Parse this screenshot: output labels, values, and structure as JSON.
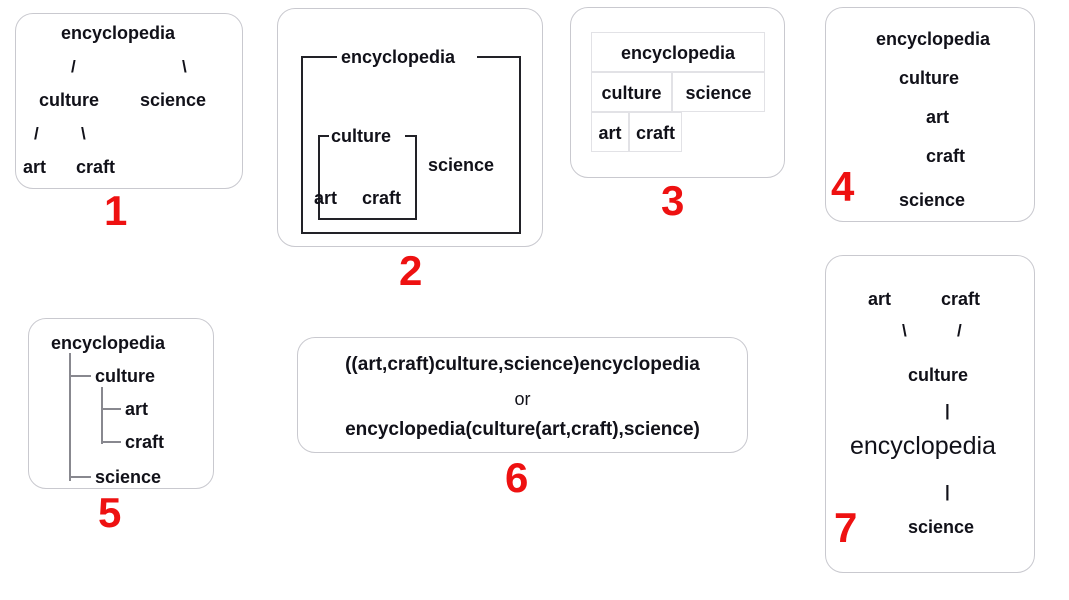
{
  "terms": {
    "encyclopedia": "encyclopedia",
    "culture": "culture",
    "science": "science",
    "art": "art",
    "craft": "craft"
  },
  "colors": {
    "number_red": "#ee1111",
    "panel_border": "#c9c9cf",
    "box_stroke": "#222228",
    "table_grid": "#e2e2e6",
    "tree_connector": "#88888f",
    "text": "#111119",
    "background": "#ffffff"
  },
  "panels": [
    {
      "number": "1",
      "style": "slash-tree",
      "nodes": {
        "root": "encyclopedia",
        "left_branch": "/",
        "right_branch": "\\",
        "level2_left": "culture",
        "level2_right": "science",
        "left_branch2": "/",
        "right_branch2": "\\",
        "level3_left": "art",
        "level3_right": "craft"
      }
    },
    {
      "number": "2",
      "style": "nested-boxes",
      "outer_label": "encyclopedia",
      "inner_label": "culture",
      "inner_items": [
        "art",
        "craft"
      ],
      "outer_item": "science"
    },
    {
      "number": "3",
      "style": "table",
      "rows": [
        {
          "cells": [
            "encyclopedia"
          ]
        },
        {
          "cells": [
            "culture",
            "science"
          ]
        },
        {
          "cells": [
            "art",
            "craft"
          ]
        }
      ]
    },
    {
      "number": "4",
      "style": "indented-outline",
      "items": [
        {
          "label": "encyclopedia",
          "indent": 0
        },
        {
          "label": "culture",
          "indent": 1
        },
        {
          "label": "art",
          "indent": 2
        },
        {
          "label": "craft",
          "indent": 2
        },
        {
          "label": "science",
          "indent": 1
        }
      ]
    },
    {
      "number": "5",
      "style": "elbow-tree",
      "items": [
        {
          "label": "encyclopedia",
          "indent": 0
        },
        {
          "label": "culture",
          "indent": 1
        },
        {
          "label": "art",
          "indent": 2
        },
        {
          "label": "craft",
          "indent": 2
        },
        {
          "label": "science",
          "indent": 1
        }
      ]
    },
    {
      "number": "6",
      "style": "parenthetical-notation",
      "line1": "((art,craft)culture,science)encyclopedia",
      "separator": "or",
      "line2": "encyclopedia(culture(art,craft),science)"
    },
    {
      "number": "7",
      "style": "inverted-tree",
      "nodes": {
        "top_left": "art",
        "top_right": "craft",
        "branch_left": "\\",
        "branch_right": "/",
        "middle": "culture",
        "stem1": "|",
        "center": "encyclopedia",
        "stem2": "|",
        "bottom": "science"
      }
    }
  ]
}
